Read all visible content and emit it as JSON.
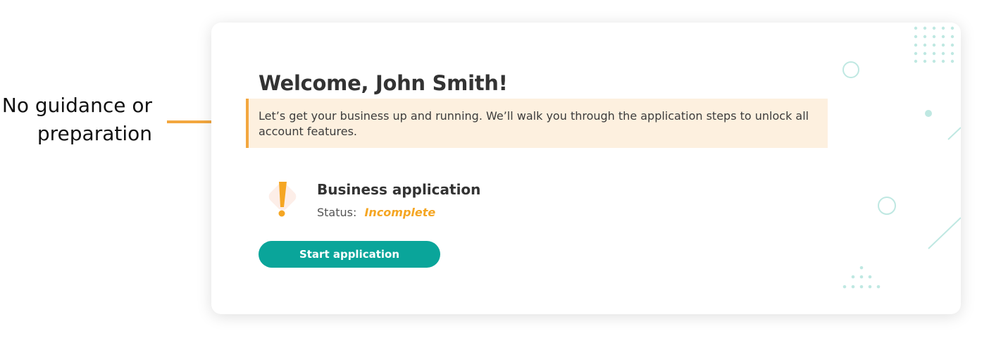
{
  "annotation": {
    "line1": "No guidance or",
    "line2": "preparation"
  },
  "welcome": {
    "title": "Welcome, John Smith!"
  },
  "callout": {
    "text": "Let’s get your business up and running. We’ll walk you through the application steps to unlock all account features."
  },
  "application": {
    "title": "Business application",
    "status_label": "Status:",
    "status_value": "Incomplete",
    "status_icon": "exclamation-icon"
  },
  "actions": {
    "start_label": "Start application"
  },
  "colors": {
    "accent": "#0aa59a",
    "warning": "#f5a623",
    "callout_bg": "#fdf0df",
    "decor": "#bfe8e2"
  }
}
